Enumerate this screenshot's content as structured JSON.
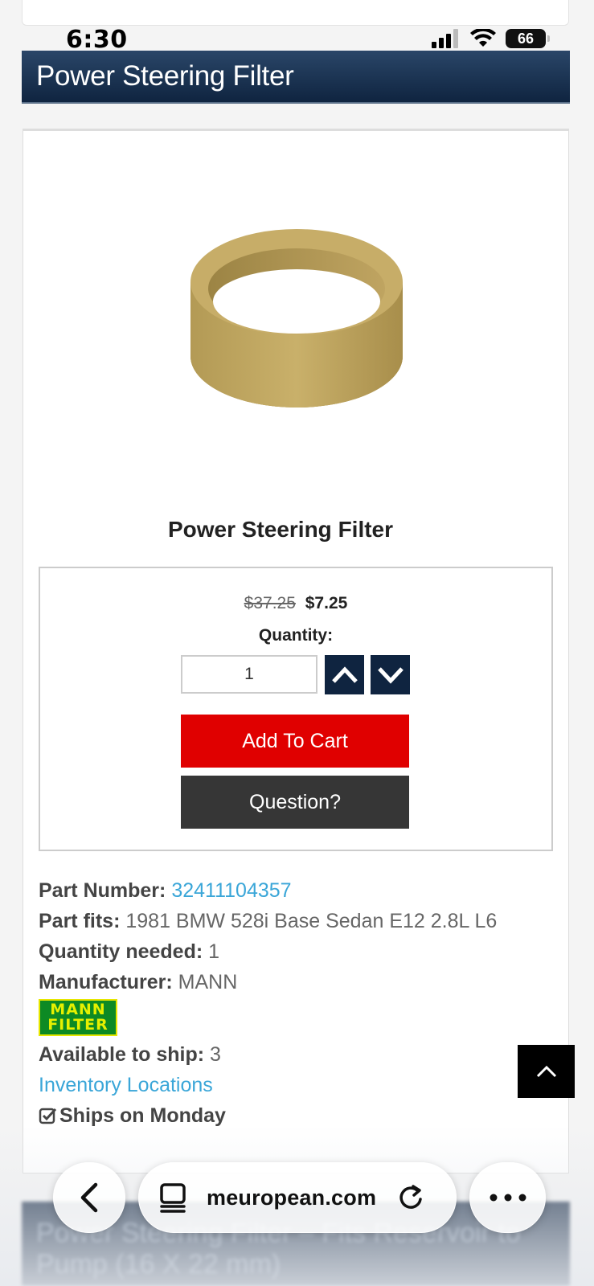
{
  "status_bar": {
    "time": "6:30",
    "battery": "66",
    "icons": [
      "cellular-signal-icon",
      "wifi-icon",
      "battery-icon"
    ]
  },
  "header": {
    "title": "Power Steering Filter"
  },
  "product": {
    "image_icon": "filter-ring-image",
    "name": "Power Steering Filter",
    "price_old": "$37.25",
    "price_new": "$7.25",
    "quantity_label": "Quantity:",
    "quantity_value": "1",
    "add_to_cart_label": "Add To Cart",
    "question_label": "Question?"
  },
  "details": {
    "part_number_label": "Part Number:",
    "part_number_value": "32411104357",
    "part_fits_label": "Part fits:",
    "part_fits_value": "1981 BMW 528i Base Sedan E12 2.8L L6",
    "quantity_needed_label": "Quantity needed:",
    "quantity_needed_value": "1",
    "manufacturer_label": "Manufacturer:",
    "manufacturer_value": "MANN",
    "logo_line1": "MANN",
    "logo_line2": "FILTER",
    "available_label": "Available to ship:",
    "available_value": "3",
    "inventory_link": "Inventory Locations",
    "ships_text": "Ships on Monday"
  },
  "next_item": {
    "title": "Power Steering Filter – Fits Reservoir to Pump (16 X 22 mm)"
  },
  "browser": {
    "url": "meuropean.com"
  },
  "colors": {
    "header_navy": "#0f2440",
    "cart_red": "#e00000",
    "question_dark": "#363636",
    "link_blue": "#3aa6d8",
    "mann_green": "#0d8a24",
    "mann_yellow": "#e6f000"
  }
}
